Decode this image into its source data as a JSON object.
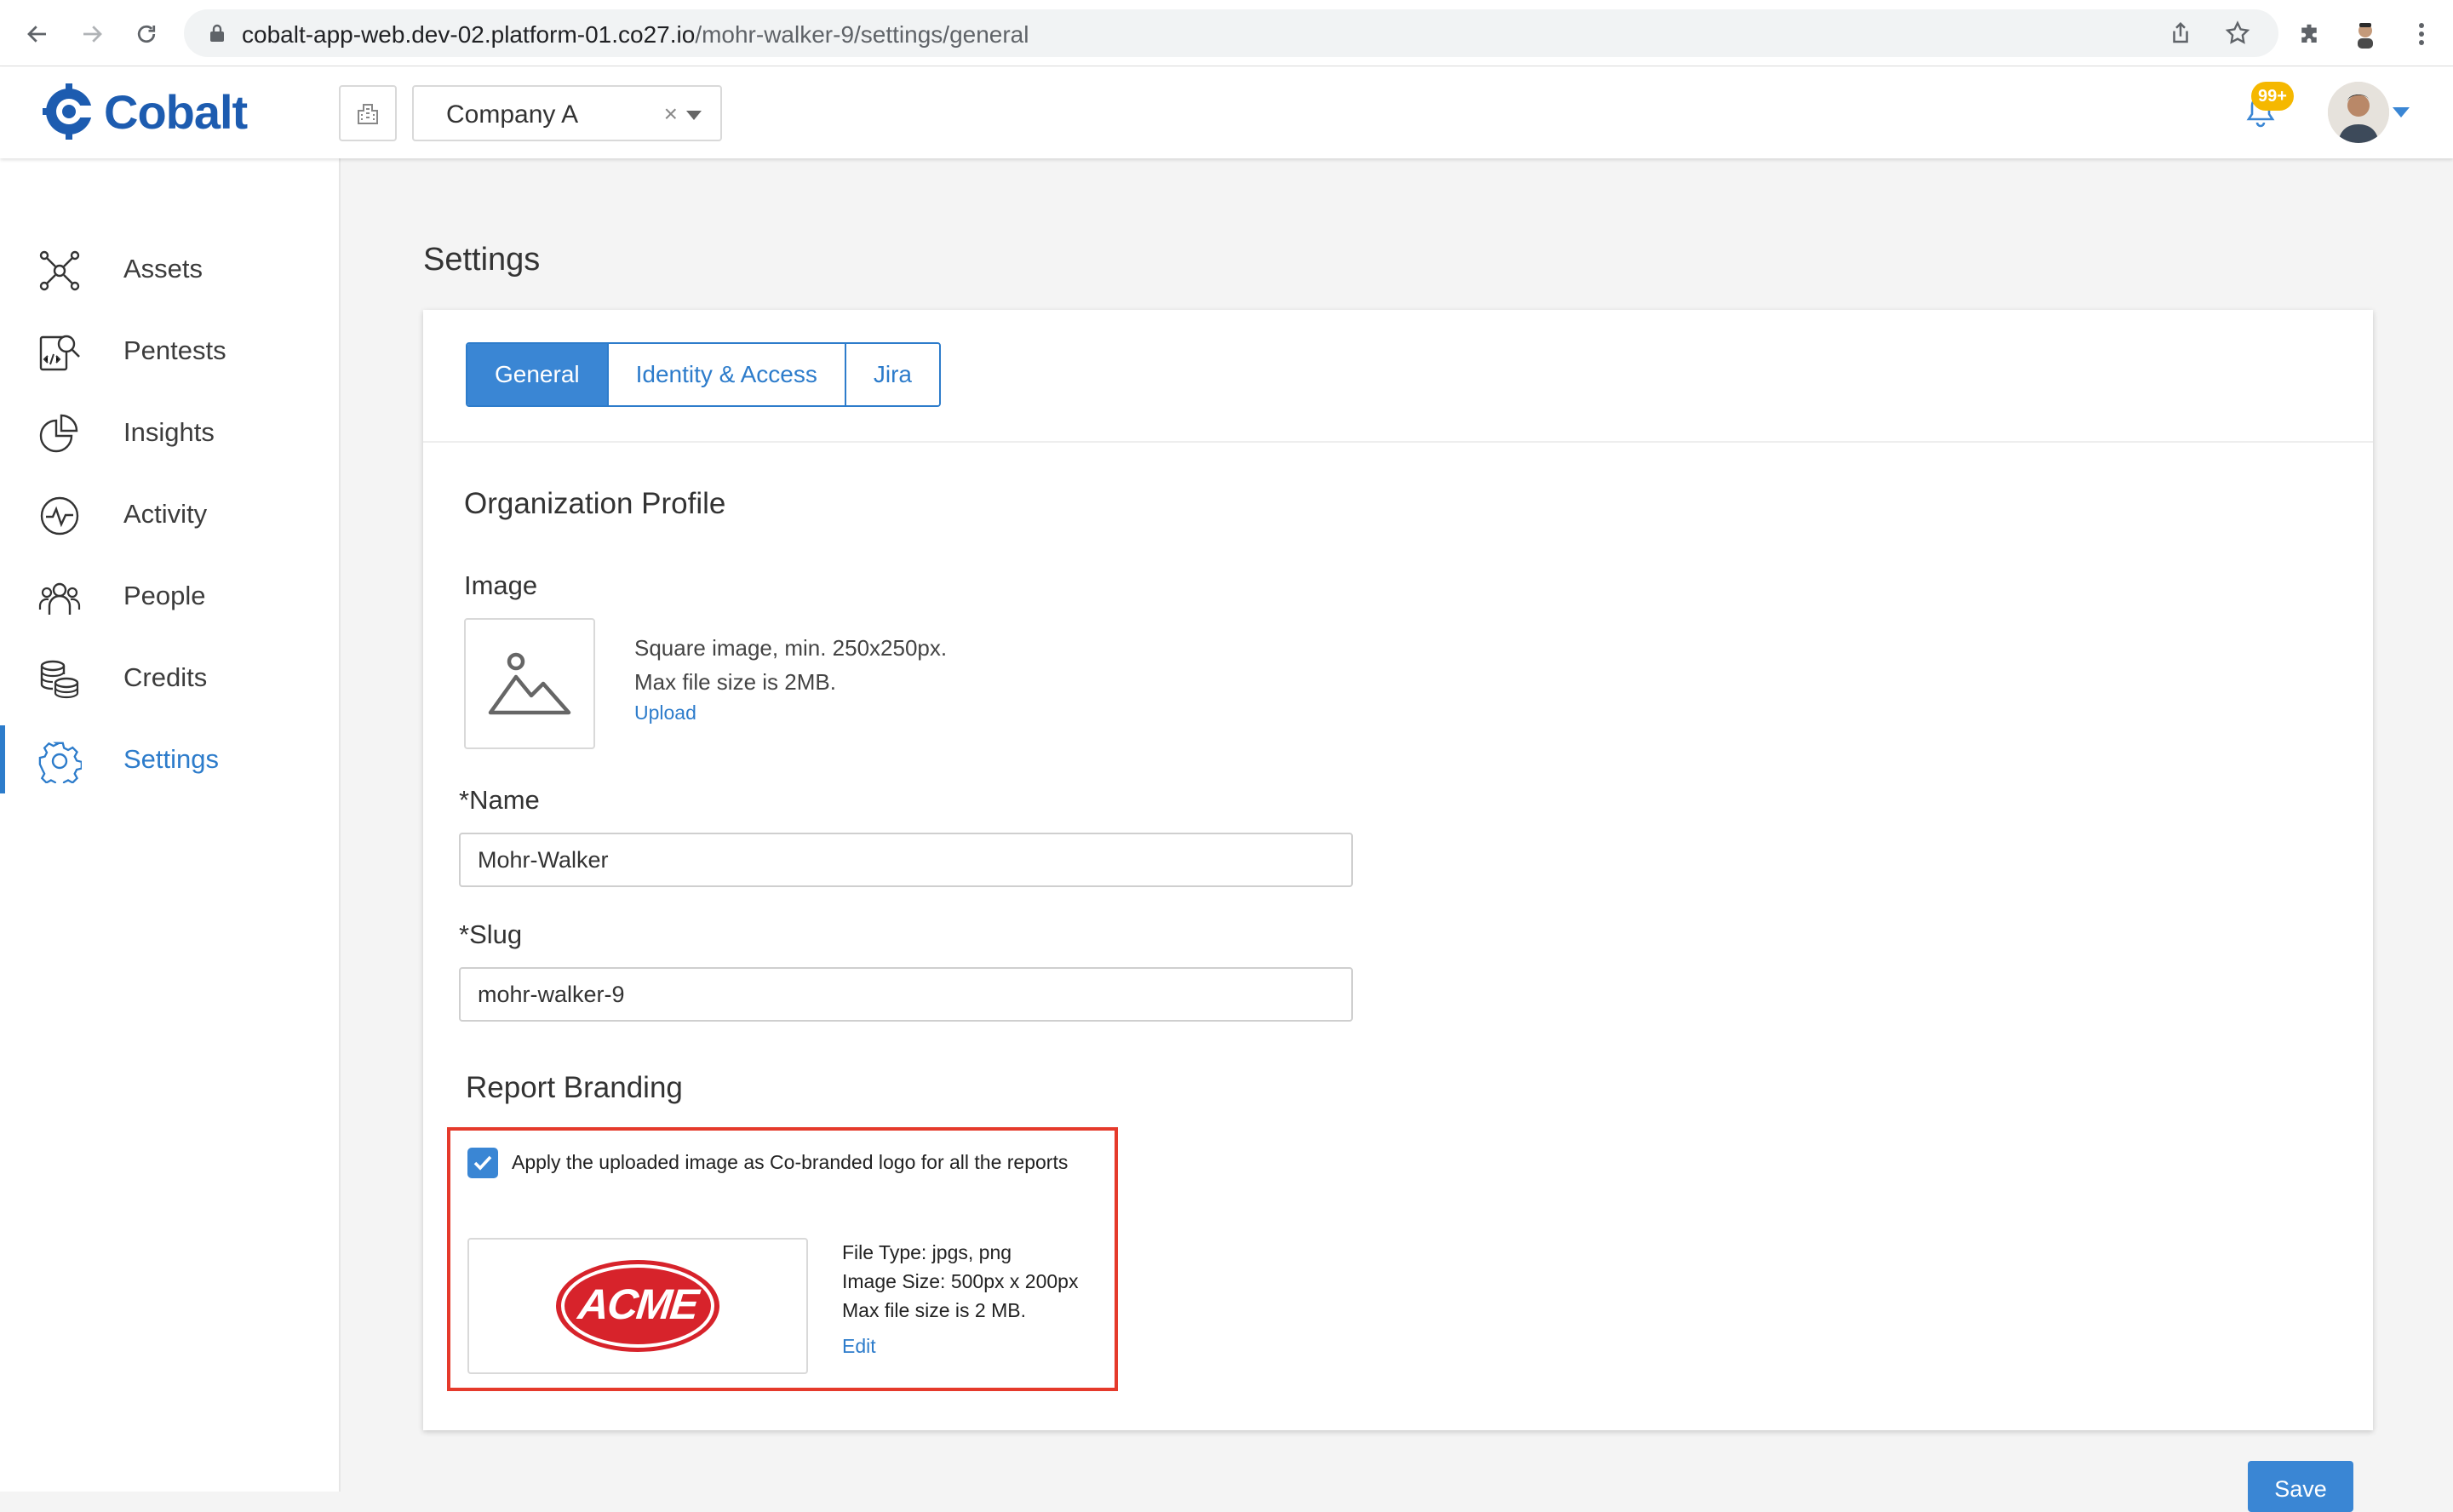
{
  "browser": {
    "url_host": "cobalt-app-web.dev-02.platform-01.co27.io",
    "url_path": "/mohr-walker-9/settings/general"
  },
  "header": {
    "app_name": "Cobalt",
    "company": "Company A",
    "clear_symbol": "×",
    "notification_badge": "99+"
  },
  "sidebar": {
    "items": [
      {
        "label": "Assets",
        "icon": "assets-icon"
      },
      {
        "label": "Pentests",
        "icon": "pentests-icon"
      },
      {
        "label": "Insights",
        "icon": "insights-icon"
      },
      {
        "label": "Activity",
        "icon": "activity-icon"
      },
      {
        "label": "People",
        "icon": "people-icon"
      },
      {
        "label": "Credits",
        "icon": "credits-icon"
      },
      {
        "label": "Settings",
        "icon": "settings-icon",
        "active": true
      }
    ]
  },
  "page": {
    "title": "Settings",
    "tabs": [
      {
        "label": "General",
        "active": true
      },
      {
        "label": "Identity & Access"
      },
      {
        "label": "Jira"
      }
    ],
    "org_profile": {
      "title": "Organization Profile",
      "image_label": "Image",
      "image_hint_1": "Square image, min. 250x250px.",
      "image_hint_2": "Max file size is 2MB.",
      "upload_link": "Upload",
      "name_label": "*Name",
      "name_value": "Mohr-Walker",
      "slug_label": "*Slug",
      "slug_value": "mohr-walker-9"
    },
    "report_branding": {
      "title": "Report Branding",
      "checkbox_checked": true,
      "checkbox_label": "Apply the uploaded image as Co-branded logo for all the reports",
      "logo_text": "ACME",
      "file_type": "File Type: jpgs, png",
      "image_size": "Image Size: 500px x 200px",
      "max_size": "Max file size is 2 MB.",
      "edit_link": "Edit"
    },
    "save_button": "Save"
  },
  "colors": {
    "accent": "#3a86d4",
    "brand": "#1d5cb0",
    "highlight": "#e53a2b",
    "badge": "#f5b800",
    "acme_red": "#d7232b"
  }
}
